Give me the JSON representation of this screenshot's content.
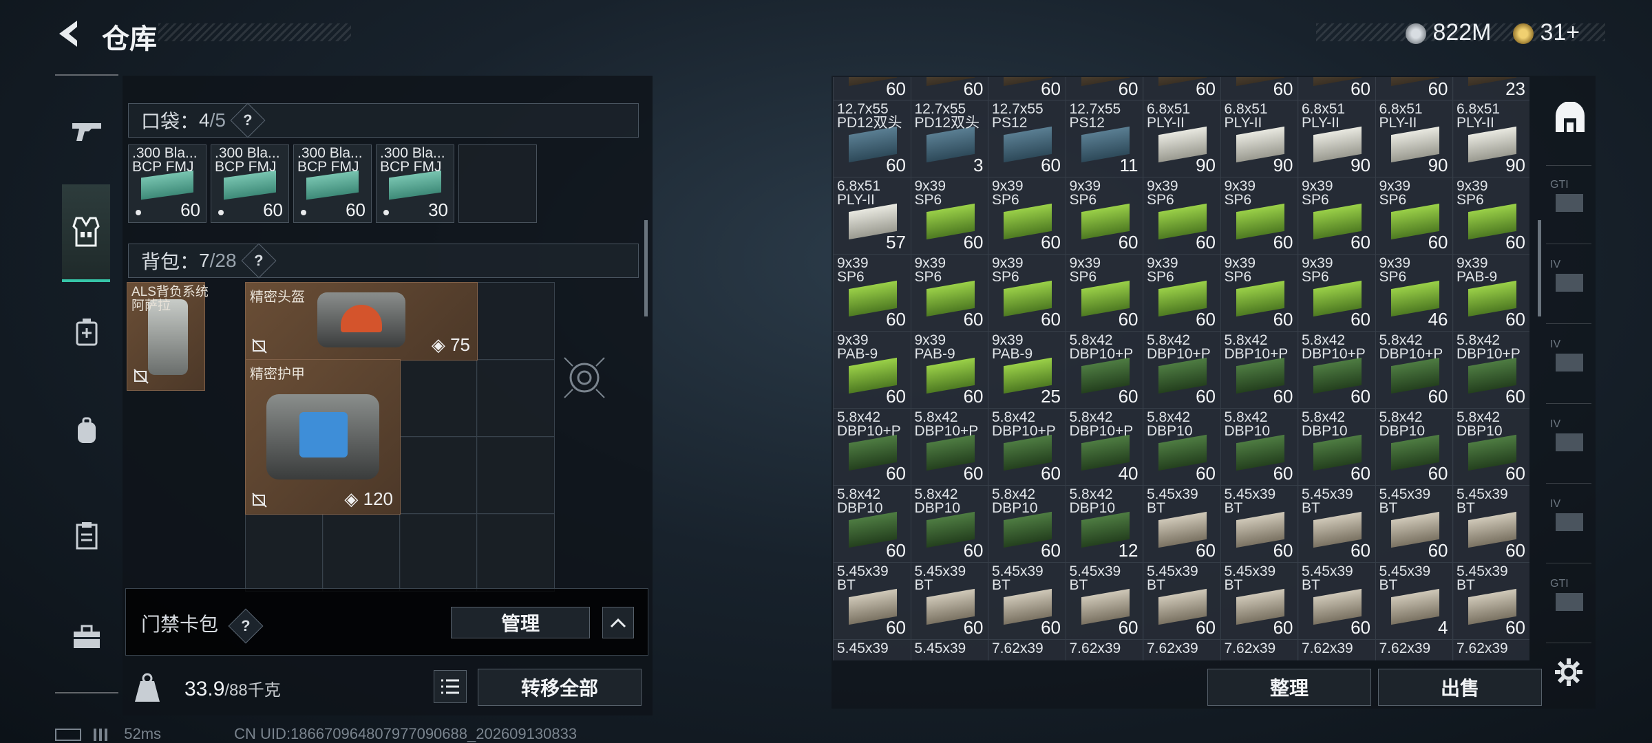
{
  "header": {
    "title": "仓库",
    "currency1": "822M",
    "currency2": "31+"
  },
  "pocket": {
    "label": "口袋：",
    "count": "4",
    "capacity": "/5",
    "help": "?",
    "items": [
      {
        "name": ".300 Bla...\nBCP FMJ",
        "count": "60"
      },
      {
        "name": ".300 Bla...\nBCP FMJ",
        "count": "60"
      },
      {
        "name": ".300 Bla...\nBCP FMJ",
        "count": "60"
      },
      {
        "name": ".300 Bla...\nBCP FMJ",
        "count": "30"
      }
    ]
  },
  "backpack": {
    "label": "背包：",
    "count": "7",
    "capacity": "/28",
    "help": "?",
    "bag": {
      "name": "ALS背负系统\n阿萨拉"
    },
    "helmet": {
      "name": "精密头盔",
      "durability": "75"
    },
    "armor": {
      "name": "精密护甲",
      "durability": "120"
    }
  },
  "keycard": {
    "label": "门禁卡包",
    "help": "?",
    "manage": "管理"
  },
  "weight": {
    "current": "33.9",
    "max": "/88千克"
  },
  "buttons": {
    "transfer_all": "转移全部",
    "sort": "整理",
    "sell": "出售"
  },
  "status": {
    "ping": "52ms",
    "uid": "CN UID:186670964807977090688_202609130833"
  },
  "right_tabs": [
    "",
    "GTI",
    "IV",
    "IV",
    "IV",
    "IV",
    "GTI"
  ],
  "warehouse": {
    "rows": [
      [
        {
          "n": "",
          "c": "60",
          "t": "t"
        },
        {
          "n": "",
          "c": "60",
          "t": "t"
        },
        {
          "n": "",
          "c": "60",
          "t": "t"
        },
        {
          "n": "",
          "c": "60",
          "t": "t"
        },
        {
          "n": "",
          "c": "60",
          "t": "t"
        },
        {
          "n": "",
          "c": "60",
          "t": "t"
        },
        {
          "n": "",
          "c": "60",
          "t": "t"
        },
        {
          "n": "",
          "c": "60",
          "t": "t"
        },
        {
          "n": "",
          "c": "23",
          "t": "t"
        }
      ],
      [
        {
          "n": "12.7x55\nPD12双头",
          "c": "60",
          "t": "s"
        },
        {
          "n": "12.7x55\nPD12双头",
          "c": "3",
          "t": "s"
        },
        {
          "n": "12.7x55\nPS12",
          "c": "60",
          "t": "s"
        },
        {
          "n": "12.7x55\nPS12",
          "c": "11",
          "t": "s"
        },
        {
          "n": "6.8x51\nPLY-II",
          "c": "90",
          "t": "y"
        },
        {
          "n": "6.8x51\nPLY-II",
          "c": "90",
          "t": "y"
        },
        {
          "n": "6.8x51\nPLY-II",
          "c": "90",
          "t": "y"
        },
        {
          "n": "6.8x51\nPLY-II",
          "c": "90",
          "t": "y"
        },
        {
          "n": "6.8x51\nPLY-II",
          "c": "90",
          "t": "y"
        }
      ],
      [
        {
          "n": "6.8x51\nPLY-II",
          "c": "57",
          "t": "y"
        },
        {
          "n": "9x39\nSP6",
          "c": "60",
          "t": "g"
        },
        {
          "n": "9x39\nSP6",
          "c": "60",
          "t": "g"
        },
        {
          "n": "9x39\nSP6",
          "c": "60",
          "t": "g"
        },
        {
          "n": "9x39\nSP6",
          "c": "60",
          "t": "g"
        },
        {
          "n": "9x39\nSP6",
          "c": "60",
          "t": "g"
        },
        {
          "n": "9x39\nSP6",
          "c": "60",
          "t": "g"
        },
        {
          "n": "9x39\nSP6",
          "c": "60",
          "t": "g"
        },
        {
          "n": "9x39\nSP6",
          "c": "60",
          "t": "g"
        }
      ],
      [
        {
          "n": "9x39\nSP6",
          "c": "60",
          "t": "g"
        },
        {
          "n": "9x39\nSP6",
          "c": "60",
          "t": "g"
        },
        {
          "n": "9x39\nSP6",
          "c": "60",
          "t": "g"
        },
        {
          "n": "9x39\nSP6",
          "c": "60",
          "t": "g"
        },
        {
          "n": "9x39\nSP6",
          "c": "60",
          "t": "g"
        },
        {
          "n": "9x39\nSP6",
          "c": "60",
          "t": "g"
        },
        {
          "n": "9x39\nSP6",
          "c": "60",
          "t": "g"
        },
        {
          "n": "9x39\nSP6",
          "c": "46",
          "t": "g"
        },
        {
          "n": "9x39\nPAB-9",
          "c": "60",
          "t": "g"
        }
      ],
      [
        {
          "n": "9x39\nPAB-9",
          "c": "60",
          "t": "g"
        },
        {
          "n": "9x39\nPAB-9",
          "c": "60",
          "t": "g"
        },
        {
          "n": "9x39\nPAB-9",
          "c": "25",
          "t": "g"
        },
        {
          "n": "5.8x42\nDBP10+P",
          "c": "60",
          "t": "d"
        },
        {
          "n": "5.8x42\nDBP10+P",
          "c": "60",
          "t": "d"
        },
        {
          "n": "5.8x42\nDBP10+P",
          "c": "60",
          "t": "d"
        },
        {
          "n": "5.8x42\nDBP10+P",
          "c": "60",
          "t": "d"
        },
        {
          "n": "5.8x42\nDBP10+P",
          "c": "60",
          "t": "d"
        },
        {
          "n": "5.8x42\nDBP10+P",
          "c": "60",
          "t": "d"
        }
      ],
      [
        {
          "n": "5.8x42\nDBP10+P",
          "c": "60",
          "t": "d"
        },
        {
          "n": "5.8x42\nDBP10+P",
          "c": "60",
          "t": "d"
        },
        {
          "n": "5.8x42\nDBP10+P",
          "c": "60",
          "t": "d"
        },
        {
          "n": "5.8x42\nDBP10+P",
          "c": "40",
          "t": "d"
        },
        {
          "n": "5.8x42\nDBP10",
          "c": "60",
          "t": "d"
        },
        {
          "n": "5.8x42\nDBP10",
          "c": "60",
          "t": "d"
        },
        {
          "n": "5.8x42\nDBP10",
          "c": "60",
          "t": "d"
        },
        {
          "n": "5.8x42\nDBP10",
          "c": "60",
          "t": "d"
        },
        {
          "n": "5.8x42\nDBP10",
          "c": "60",
          "t": "d"
        }
      ],
      [
        {
          "n": "5.8x42\nDBP10",
          "c": "60",
          "t": "d"
        },
        {
          "n": "5.8x42\nDBP10",
          "c": "60",
          "t": "d"
        },
        {
          "n": "5.8x42\nDBP10",
          "c": "60",
          "t": "d"
        },
        {
          "n": "5.8x42\nDBP10",
          "c": "12",
          "t": "d"
        },
        {
          "n": "5.45x39\nBT",
          "c": "60",
          "t": "w"
        },
        {
          "n": "5.45x39\nBT",
          "c": "60",
          "t": "w"
        },
        {
          "n": "5.45x39\nBT",
          "c": "60",
          "t": "w"
        },
        {
          "n": "5.45x39\nBT",
          "c": "60",
          "t": "w"
        },
        {
          "n": "5.45x39\nBT",
          "c": "60",
          "t": "w"
        }
      ],
      [
        {
          "n": "5.45x39\nBT",
          "c": "60",
          "t": "w"
        },
        {
          "n": "5.45x39\nBT",
          "c": "60",
          "t": "w"
        },
        {
          "n": "5.45x39\nBT",
          "c": "60",
          "t": "w"
        },
        {
          "n": "5.45x39\nBT",
          "c": "60",
          "t": "w"
        },
        {
          "n": "5.45x39\nBT",
          "c": "60",
          "t": "w"
        },
        {
          "n": "5.45x39\nBT",
          "c": "60",
          "t": "w"
        },
        {
          "n": "5.45x39\nBT",
          "c": "60",
          "t": "w"
        },
        {
          "n": "5.45x39\nBT",
          "c": "4",
          "t": "w"
        },
        {
          "n": "5.45x39\nBT",
          "c": "60",
          "t": "w"
        }
      ],
      [
        {
          "n": "5.45x39",
          "c": "",
          "t": "w"
        },
        {
          "n": "5.45x39",
          "c": "",
          "t": "w"
        },
        {
          "n": "7.62x39",
          "c": "",
          "t": "w"
        },
        {
          "n": "7.62x39",
          "c": "",
          "t": "w"
        },
        {
          "n": "7.62x39",
          "c": "",
          "t": "w"
        },
        {
          "n": "7.62x39",
          "c": "",
          "t": "w"
        },
        {
          "n": "7.62x39",
          "c": "",
          "t": "w"
        },
        {
          "n": "7.62x39",
          "c": "",
          "t": "w"
        },
        {
          "n": "7.62x39",
          "c": "",
          "t": "w"
        }
      ]
    ]
  },
  "colors": {
    "accent": "#36c5a8",
    "item_bg": "#6a4e36",
    "ammo_green": "#7fbf3a",
    "ammo_teal": "#4c9c8a"
  }
}
